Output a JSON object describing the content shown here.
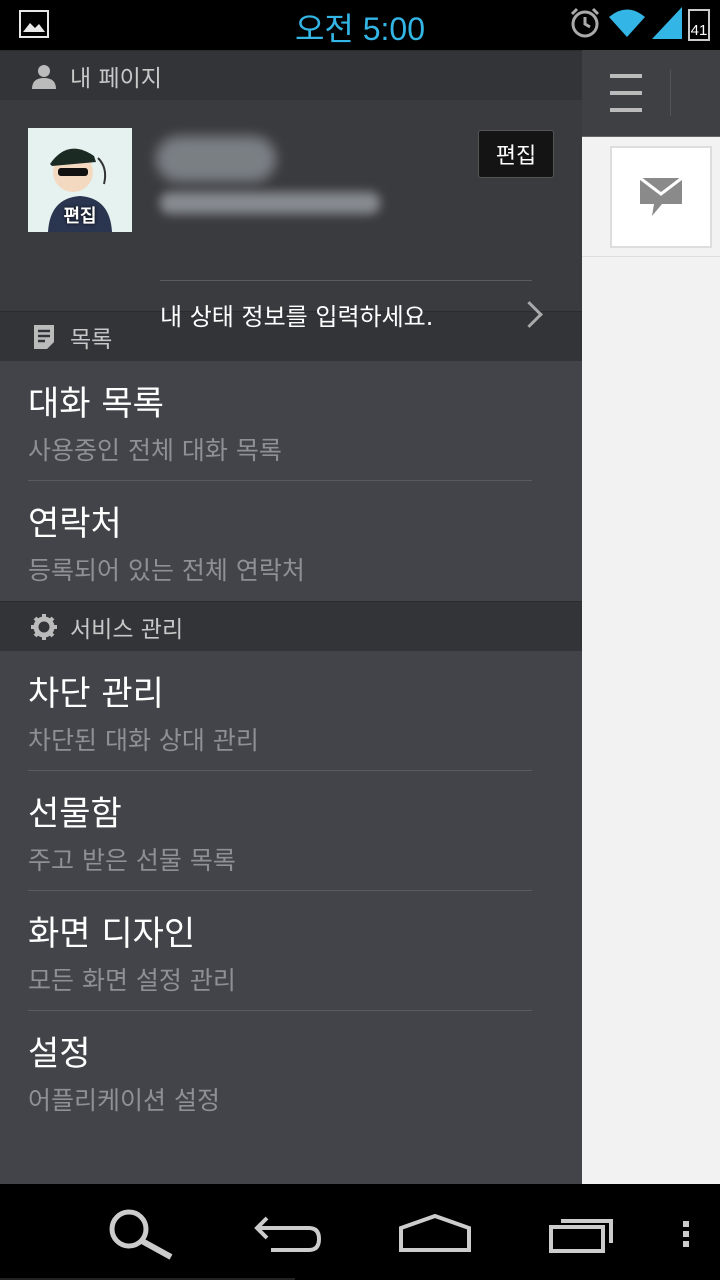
{
  "status_bar": {
    "time": "오전 5:00",
    "battery": "41"
  },
  "drawer": {
    "my_page_header": "내 페이지",
    "profile": {
      "avatar_edit_label": "편집",
      "edit_button": "편집",
      "status_prompt": "내 상태 정보를 입력하세요."
    },
    "list_header": "목록",
    "list_items": [
      {
        "title": "대화 목록",
        "subtitle": "사용중인 전체 대화 목록"
      },
      {
        "title": "연락처",
        "subtitle": "등록되어 있는 전체 연락처"
      }
    ],
    "service_header": "서비스 관리",
    "service_items": [
      {
        "title": "차단 관리",
        "subtitle": "차단된 대화 상대 관리"
      },
      {
        "title": "선물함",
        "subtitle": "주고 받은 선물 목록"
      },
      {
        "title": "화면 디자인",
        "subtitle": "모든 화면 설정 관리"
      },
      {
        "title": "설정",
        "subtitle": "어플리케이션 설정"
      }
    ]
  },
  "icons": {
    "status_left": "gallery-icon",
    "status_right": [
      "alarm-icon",
      "wifi-icon",
      "signal-icon",
      "battery-icon"
    ],
    "headers": [
      "person-icon",
      "list-icon",
      "gear-icon"
    ],
    "right_panel": [
      "menu-icon",
      "message-icon"
    ],
    "nav": [
      "search-icon",
      "back-icon",
      "home-icon",
      "recent-apps-icon",
      "overflow-icon"
    ]
  },
  "colors": {
    "clock": "#33b5e5",
    "drawer_bg": "#424449",
    "header_bg": "#333438",
    "subtitle": "#8e9096"
  }
}
